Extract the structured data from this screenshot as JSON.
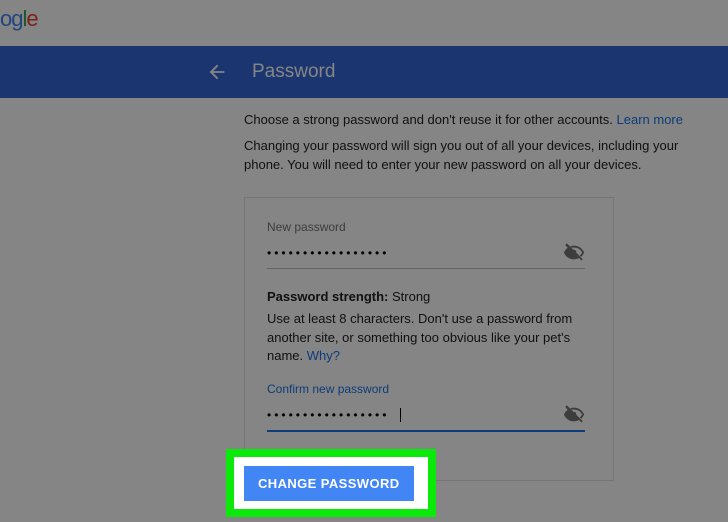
{
  "logo": {
    "chars": [
      "o",
      "g",
      "l",
      "e"
    ]
  },
  "header": {
    "title": "Password"
  },
  "intro": {
    "line1": "Choose a strong password and don't reuse it for other accounts.",
    "learn_more": "Learn more",
    "line2": "Changing your password will sign you out of all your devices, including your phone. You will need to enter your new password on all your devices."
  },
  "card": {
    "new_password_label": "New password",
    "new_password_value": "•••••••••••••••••",
    "strength_label": "Password strength:",
    "strength_value": "Strong",
    "hint": "Use at least 8 characters. Don't use a password from another site, or something too obvious like your pet's name.",
    "hint_link": "Why?",
    "confirm_label": "Confirm new password",
    "confirm_value": "•••••••••••••••••"
  },
  "actions": {
    "change_password": "CHANGE PASSWORD"
  },
  "colors": {
    "highlight": "#0be90b",
    "primary": "#4285f4",
    "header": "#3367d6",
    "link": "#1a73e8"
  }
}
